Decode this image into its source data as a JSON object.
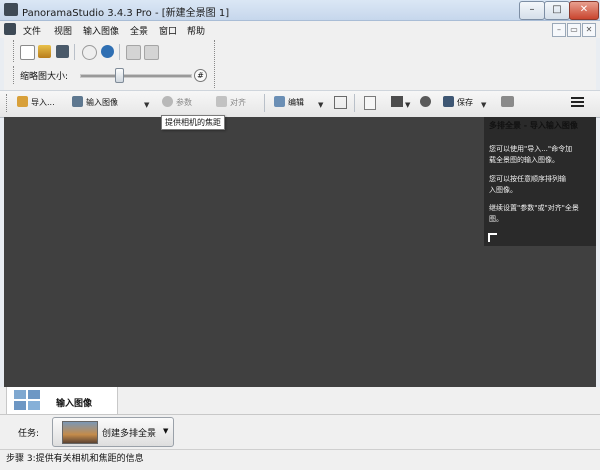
{
  "window": {
    "title": "PanoramaStudio 3.4.3 Pro - [新建全景图 1]",
    "minimize": "–",
    "maximize": "□",
    "close": "✕"
  },
  "menu": [
    "文件",
    "视图",
    "输入图像",
    "全景",
    "窗口",
    "帮助"
  ],
  "mdi_buttons": [
    "–",
    "▭",
    "✕"
  ],
  "thumbnail": {
    "label": "缩略图大小:",
    "slider_value": 0.35,
    "hash_button": "#"
  },
  "toolbar": {
    "import": "导入...",
    "input_image": "输入图像",
    "params": "参数",
    "align": "对齐",
    "edit": "编辑",
    "save": "保存"
  },
  "tooltip": "提供相机的焦距",
  "help_panel": {
    "title": "多排全景 - 导入输入图像",
    "lines": [
      "您可以使用\"导入...\"命令加",
      "载全景图的输入图像。",
      "您可以按任意顺序排列输",
      "入图像。",
      "继续设置\"参数\"或\"对齐\"全景",
      "图。"
    ]
  },
  "tab": {
    "label": "输入图像"
  },
  "task": {
    "label": "任务:",
    "value": "创建多排全景",
    "caret": "▼"
  },
  "status": "步骤 3:提供有关相机和焦距的信息",
  "colors": {
    "workspace": "#404040",
    "help_panel": "#2a2a2a",
    "titlebar": "#c6d7ec",
    "close_button": "#c9452f"
  }
}
